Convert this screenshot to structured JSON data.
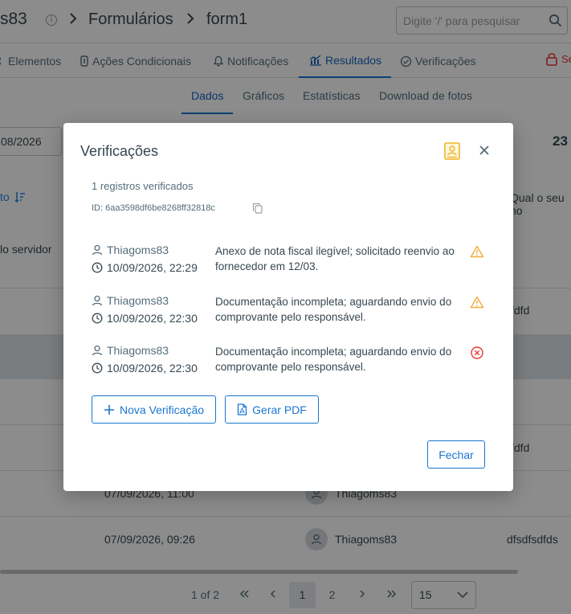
{
  "header": {
    "crumb_project": "s83",
    "crumb_forms": "Formulários",
    "crumb_form": "form1",
    "search_placeholder": "Digite '/' para pesquisar"
  },
  "tabs": [
    {
      "label": "Elementos",
      "icon": "grid-icon"
    },
    {
      "label": "Ações Condicionais",
      "icon": "conditional-icon"
    },
    {
      "label": "Notificações",
      "icon": "bell-icon"
    },
    {
      "label": "Resultados",
      "icon": "chart-icon",
      "active": true
    },
    {
      "label": "Verificações",
      "icon": "check-circle-icon"
    }
  ],
  "tab_lock_label": "Se",
  "subtabs": [
    {
      "label": "Dados",
      "active": true
    },
    {
      "label": "Gráficos"
    },
    {
      "label": "Estatísticas"
    },
    {
      "label": "Download de fotos"
    }
  ],
  "background": {
    "date_filter": "08/2026",
    "count": "23",
    "sort_label": "to",
    "col_server": "lo servidor",
    "col_question": "Qual o seu no",
    "rows": [
      {
        "answer": "fdfd"
      },
      {
        "answer": "fdfd"
      },
      {
        "date": "07/09/2026, 11:00",
        "user": "Thiagoms83"
      },
      {
        "date": "07/09/2026, 09:26",
        "user": "Thiagoms83",
        "answer": "dfsdfsdfds"
      }
    ]
  },
  "pagination": {
    "summary": "1 of 2",
    "pages": [
      "1",
      "2"
    ],
    "current": "1",
    "page_size": "15"
  },
  "modal": {
    "title": "Verificações",
    "count_text": "1 registros verificados",
    "id_text": "ID: 6aa3598df6be8268ff32818c",
    "entries": [
      {
        "user": "Thiagoms83",
        "time": "10/09/2026, 22:29",
        "text": "Anexo de nota fiscal ilegível; solicitado reenvio ao fornecedor em 12/03.",
        "status": "warning"
      },
      {
        "user": "Thiagoms83",
        "time": "10/09/2026, 22:30",
        "text": "Documentação incompleta; aguardando envio do comprovante pelo responsável.",
        "status": "warning"
      },
      {
        "user": "Thiagoms83",
        "time": "10/09/2026, 22:30",
        "text": "Documentação incompleta; aguardando envio do comprovante pelo responsável.",
        "status": "rejected"
      }
    ],
    "btn_new": "Nova Verificação",
    "btn_pdf": "Gerar PDF",
    "btn_close": "Fechar"
  },
  "colors": {
    "accent": "#1976d2",
    "warning": "#f2a93b",
    "error": "#e53935",
    "badge": "#f5c242"
  }
}
